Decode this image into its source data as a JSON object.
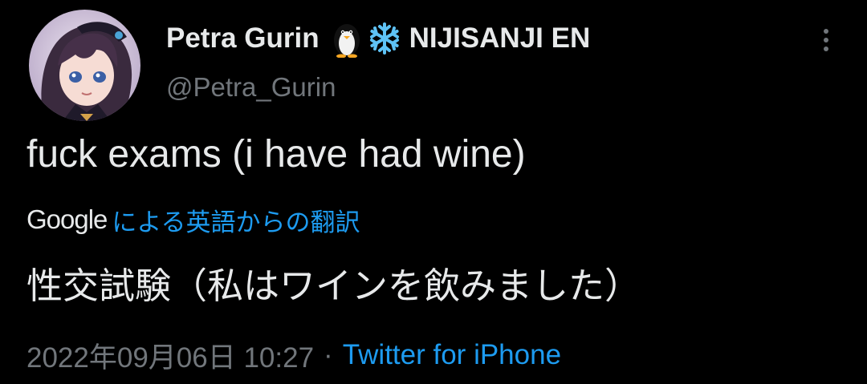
{
  "tweet": {
    "display_name": "Petra Gurin",
    "org": "NIJISANJI EN",
    "handle": "@Petra_Gurin",
    "text": "fuck exams (i have had wine)",
    "translation": {
      "provider": "Google",
      "label": "による英語からの翻訳",
      "text": "性交試験（私はワインを飲みました）"
    },
    "timestamp": "2022年09月06日 10:27",
    "separator": "·",
    "source": "Twitter for iPhone"
  },
  "icons": {
    "name_emojis": [
      "penguin-icon",
      "snowflake-icon"
    ],
    "menu": "more-options-icon"
  },
  "colors": {
    "background": "#000000",
    "primary_text": "#e7e9ea",
    "secondary_text": "#71767b",
    "accent": "#1d9bf0"
  }
}
